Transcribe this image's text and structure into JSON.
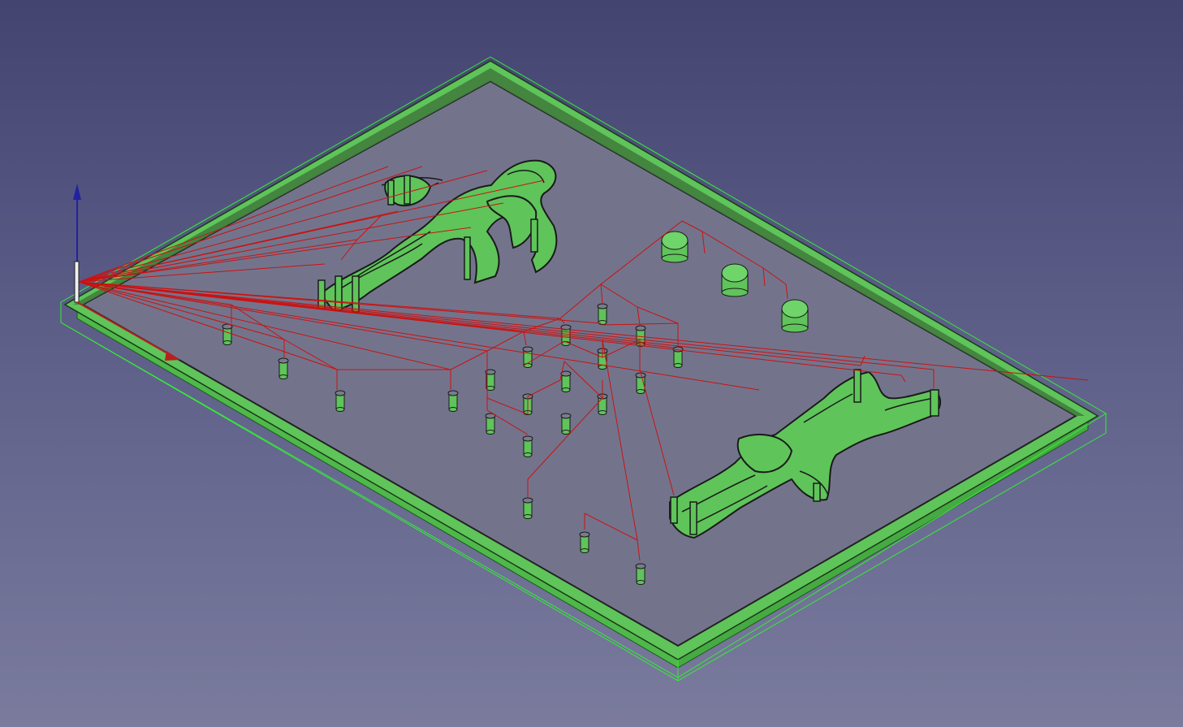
{
  "viewport": {
    "background_top": "#434470",
    "background_bottom": "#7a7b9d",
    "stock_color": "#5fc45a",
    "stock_edge_color": "#33dd33",
    "part_fill": "#6dc66a",
    "toolpath_color": "#cc1111",
    "outline_color": "#1a1a1a",
    "axis_z_color": "#2222a0",
    "axis_x_color": "#b82020"
  }
}
